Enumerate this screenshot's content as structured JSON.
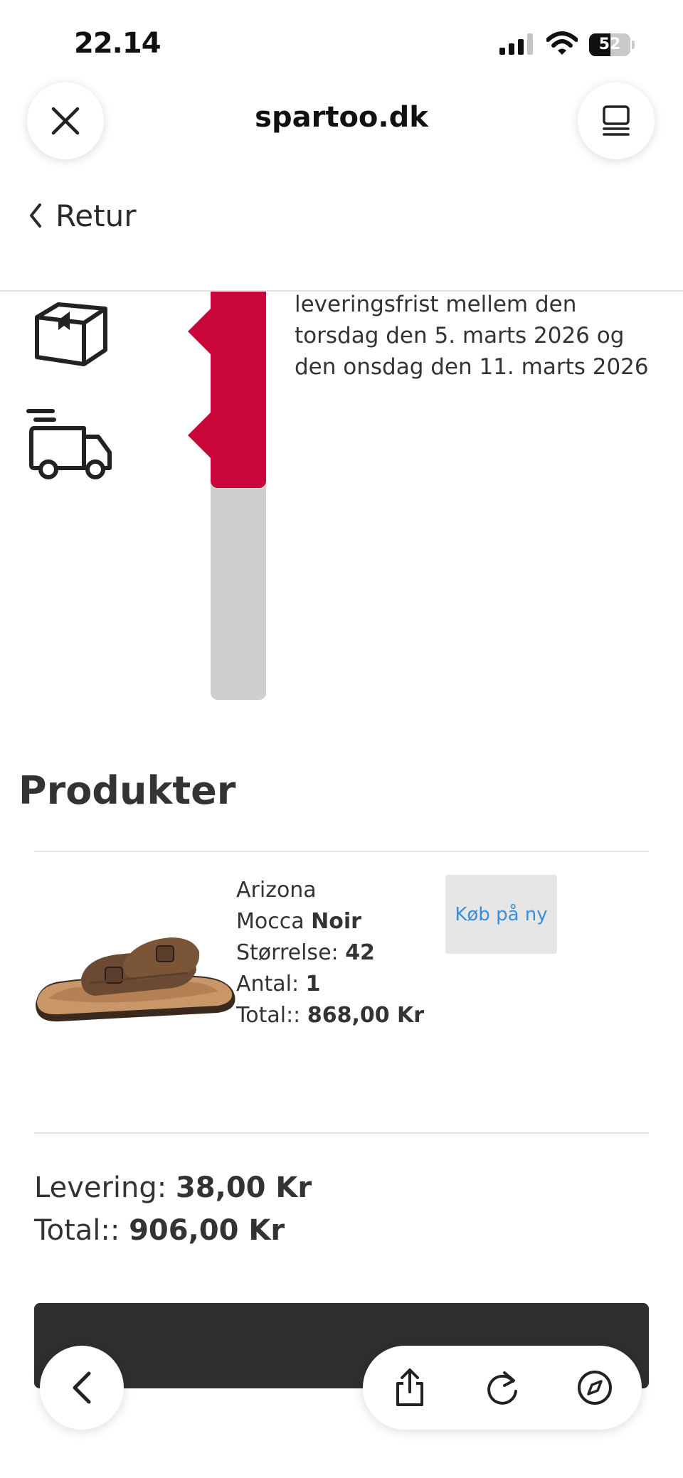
{
  "status_bar": {
    "time": "22.14",
    "battery_percent": "52",
    "battery_level": 0.52,
    "signal_bars_active": 3,
    "signal_bars_total": 4
  },
  "browser": {
    "site": "spartoo.dk",
    "close_icon": "close-icon",
    "tabs_icon": "tabs-icon"
  },
  "nav": {
    "back_label": "Retur"
  },
  "tracking": {
    "delivery_text": "leveringsfrist mellem den torsdag den 5. marts 2026 og den onsdag den 11. marts 2026",
    "progress": 0.48,
    "colors": {
      "active": "#c8063a",
      "inactive": "#cfcfcf"
    },
    "icons": [
      "package-icon",
      "truck-icon"
    ]
  },
  "products": {
    "title": "Produkter",
    "items": [
      {
        "name": "Arizona",
        "color_prefix": "Mocca",
        "color_value": "Noir",
        "size_label": "Størrelse:",
        "size_value": "42",
        "qty_label": "Antal:",
        "qty_value": "1",
        "total_label": "Total::",
        "total_value": "868,00 Kr",
        "buy_again_label": "Køb på ny",
        "image": "sandal-image"
      }
    ]
  },
  "summary": {
    "delivery_label": "Levering:",
    "delivery_value": "38,00 Kr",
    "total_label": "Total::",
    "total_value": "906,00 Kr"
  },
  "toolbar": {
    "back_icon": "chevron-left-icon",
    "share_icon": "share-icon",
    "reload_icon": "reload-icon",
    "compass_icon": "compass-icon"
  },
  "theme": {
    "accent": "#c8063a",
    "link": "#3b8fd6",
    "text": "#333333"
  }
}
